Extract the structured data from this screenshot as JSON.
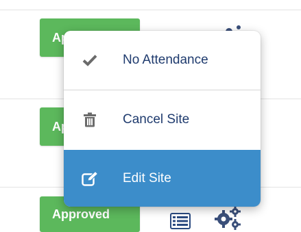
{
  "rows": [
    {
      "status": "Approved"
    },
    {
      "status": "Approved"
    },
    {
      "status": "Approved"
    }
  ],
  "row_icons": {
    "list": "list-icon",
    "settings": "gears-icon"
  },
  "menu": {
    "items": [
      {
        "label": "No Attendance",
        "icon": "check-icon"
      },
      {
        "label": "Cancel Site",
        "icon": "trash-icon"
      },
      {
        "label": "Edit Site",
        "icon": "edit-icon",
        "highlighted": true
      }
    ]
  },
  "colors": {
    "approved": "#5cb85c",
    "menu_highlight": "#3c8dca",
    "menu_text": "#1f3b6e",
    "icon_gray": "#6b6b6b"
  }
}
